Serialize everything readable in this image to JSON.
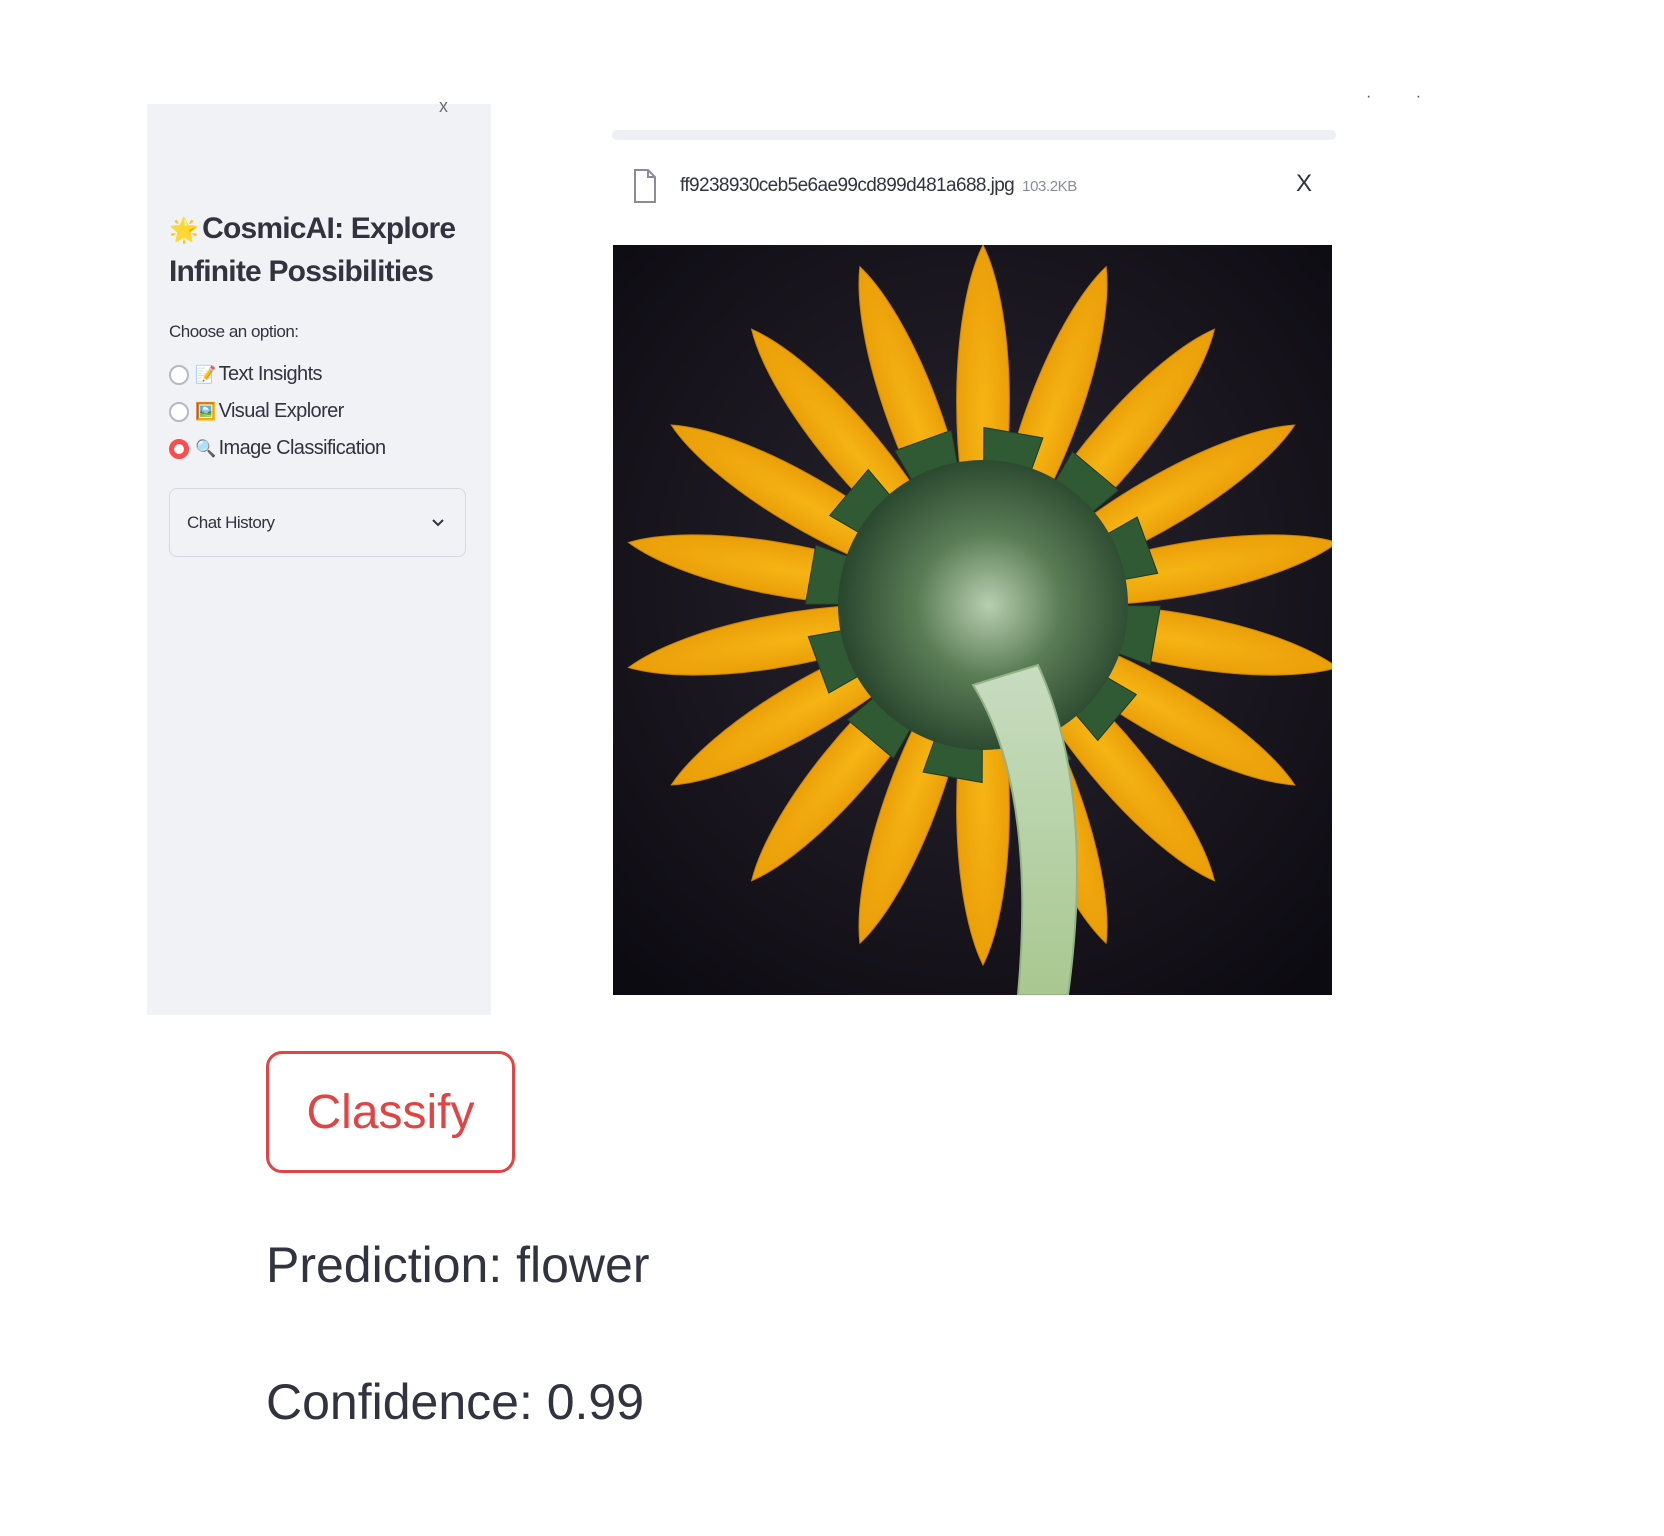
{
  "sidebar": {
    "close_glyph": "x",
    "title_emoji": "🌟",
    "title": "CosmicAI: Explore Infinite Possibilities",
    "choose_label": "Choose an option:",
    "options": [
      {
        "emoji": "📝",
        "label": "Text Insights",
        "selected": false
      },
      {
        "emoji": "🖼️",
        "label": "Visual Explorer",
        "selected": false
      },
      {
        "emoji": "🔍",
        "label": "Image Classification",
        "selected": true
      }
    ],
    "expander_label": "Chat History"
  },
  "uploader": {
    "file_name": "ff9238930ceb5e6ae99cd899d481a688.jpg",
    "file_size": "103.2KB",
    "remove_glyph": "X"
  },
  "main": {
    "classify_label": "Classify",
    "prediction_text": "Prediction: flower",
    "confidence_text": "Confidence: 0.99"
  },
  "colors": {
    "accent": "#ff4b4b",
    "sidebar_bg": "#f0f2f6",
    "text": "#31333f"
  },
  "icons": {
    "file": "file-icon",
    "chevron": "chevron-down-icon",
    "close": "close-icon"
  }
}
